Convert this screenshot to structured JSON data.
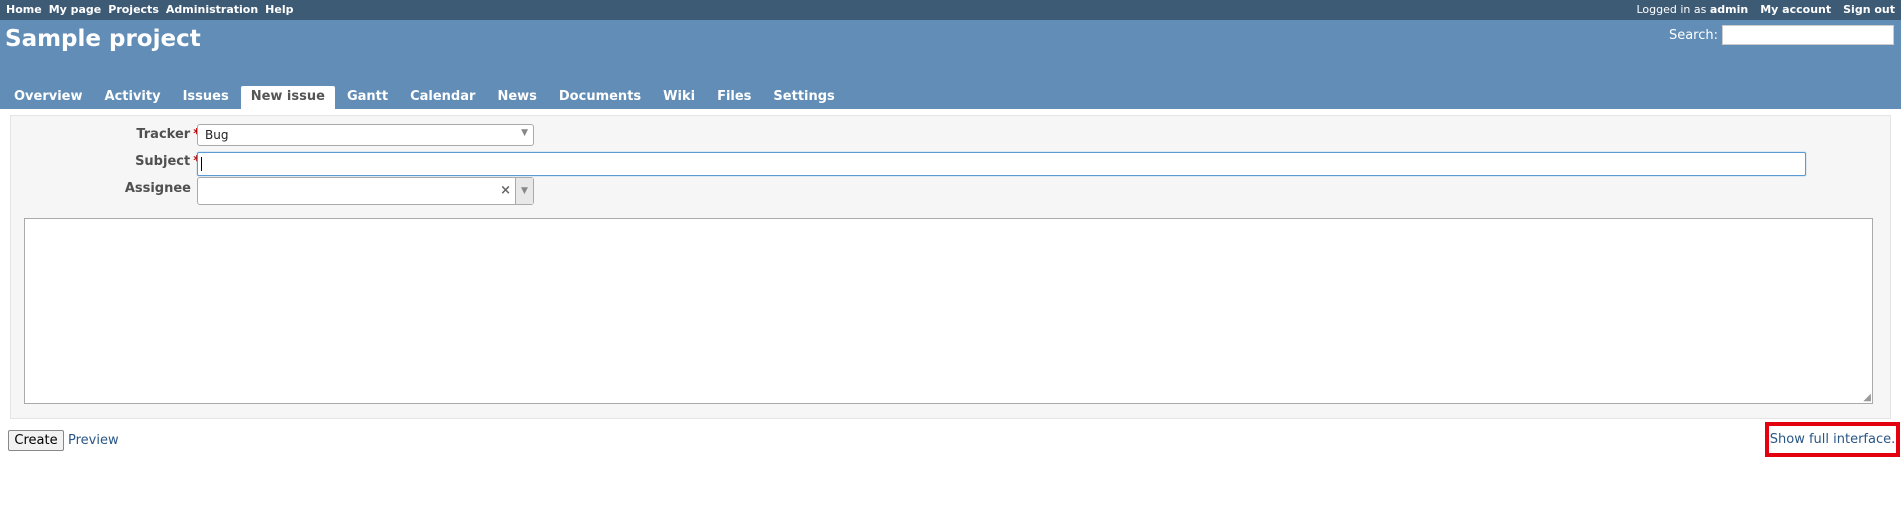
{
  "top_menu": {
    "items": [
      "Home",
      "My page",
      "Projects",
      "Administration",
      "Help"
    ],
    "logged_prefix": "Logged in as",
    "user": "admin",
    "my_account": "My account",
    "sign_out": "Sign out"
  },
  "header": {
    "title": "Sample project",
    "search_label": "Search:",
    "search_value": ""
  },
  "main_menu": {
    "tabs": [
      {
        "label": "Overview",
        "selected": false
      },
      {
        "label": "Activity",
        "selected": false
      },
      {
        "label": "Issues",
        "selected": false
      },
      {
        "label": "New issue",
        "selected": true
      },
      {
        "label": "Gantt",
        "selected": false
      },
      {
        "label": "Calendar",
        "selected": false
      },
      {
        "label": "News",
        "selected": false
      },
      {
        "label": "Documents",
        "selected": false
      },
      {
        "label": "Wiki",
        "selected": false
      },
      {
        "label": "Files",
        "selected": false
      },
      {
        "label": "Settings",
        "selected": false
      }
    ]
  },
  "form": {
    "tracker_label": "Tracker",
    "tracker_value": "Bug",
    "subject_label": "Subject",
    "subject_value": "",
    "assignee_label": "Assignee",
    "assignee_value": "",
    "required_mark": "*",
    "clear_symbol": "×",
    "description_value": ""
  },
  "actions": {
    "create_label": "Create",
    "preview_label": "Preview",
    "show_full_label": "Show full interface."
  },
  "colors": {
    "top_bar": "#3e5b76",
    "header": "#628db6",
    "link": "#2a5685",
    "highlight": "#e3000f"
  }
}
